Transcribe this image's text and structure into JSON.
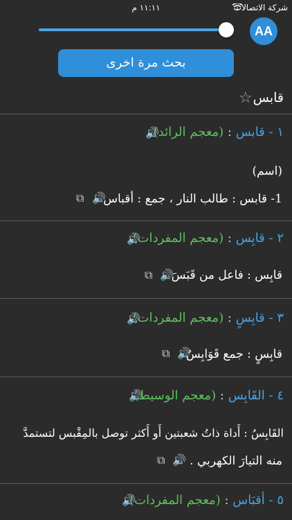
{
  "status": {
    "carrier": "شركة الاتصالات",
    "time": "١١:١١ م"
  },
  "controls": {
    "aa_label": "AA",
    "search_again": "بحث مرة اخرى"
  },
  "word": {
    "text": "قابس",
    "star": "☆"
  },
  "entries": [
    {
      "num": "١ -",
      "word": "قابس",
      "sep": ":",
      "dict": "(معجم الرائد)",
      "lines": [
        "(اسم)",
        "1- قابس : طالب النار ، جمع : أقباس"
      ]
    },
    {
      "num": "٢ -",
      "word": "قابِس",
      "sep": ":",
      "dict": "(معجم المفردات)",
      "lines": [
        "قابِس : فاعل من قَبَسَ"
      ]
    },
    {
      "num": "٣ -",
      "word": "قابِسٍ",
      "sep": ":",
      "dict": "(معجم المفردات)",
      "lines": [
        "قابِسٍ : جمع قَوَابِسُ"
      ]
    },
    {
      "num": "٤ -",
      "word": "القَابِس",
      "sep": ":",
      "dict": "(معجم الوسيط)",
      "lines": [
        "القَابِسُ : أَداة ذاتُ شعبتين أَو أَكثر توصل بالمِقْبس لتستمدَّ",
        "منه التيارَ الكهربي ."
      ]
    },
    {
      "num": "٥ -",
      "word": "أقبَاس",
      "sep": ":",
      "dict": "(معجم المفردات)",
      "lines": []
    }
  ],
  "icons": {
    "speaker": "🔊",
    "copy": "⧉",
    "wifi": "wifi-icon"
  }
}
